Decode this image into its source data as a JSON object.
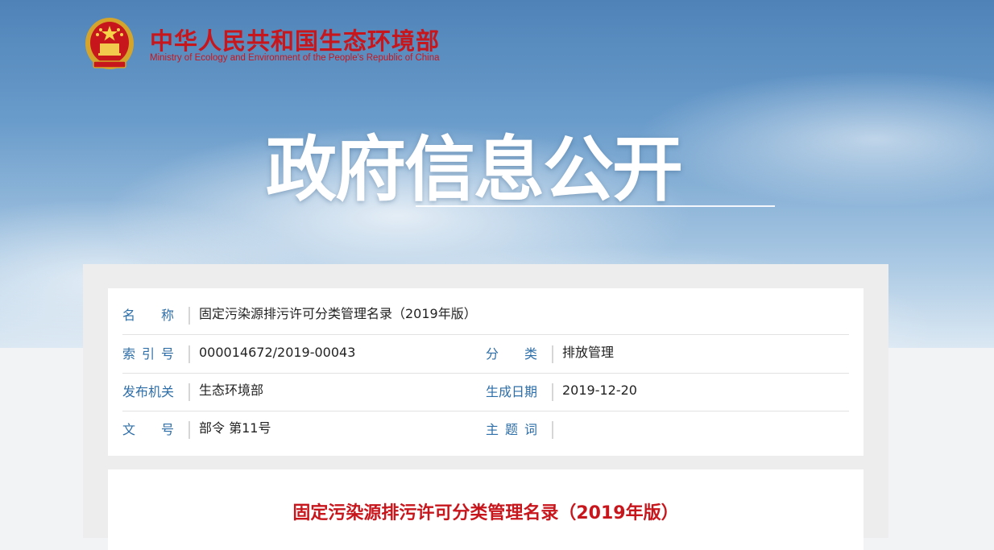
{
  "header": {
    "brand_cn": "中华人民共和国生态环境部",
    "brand_en": "Ministry of Ecology and Environment of the People's Republic of China",
    "hero_title": "政府信息公开"
  },
  "meta": {
    "name_label": "名　　称",
    "name_value": "固定污染源排污许可分类管理名录（2019年版）",
    "index_label": "索 引 号",
    "index_value": "000014672/2019-00043",
    "category_label": "分　　类",
    "category_value": "排放管理",
    "publisher_label": "发布机关",
    "publisher_value": "生态环境部",
    "date_label": "生成日期",
    "date_value": "2019-12-20",
    "docno_label": "文　　号",
    "docno_value": "部令 第11号",
    "keywords_label": "主 题 词",
    "keywords_value": ""
  },
  "document": {
    "title": "固定污染源排污许可分类管理名录（2019年版）"
  },
  "colors": {
    "brand_red": "#c8161d",
    "label_blue": "#2d6ea8"
  }
}
